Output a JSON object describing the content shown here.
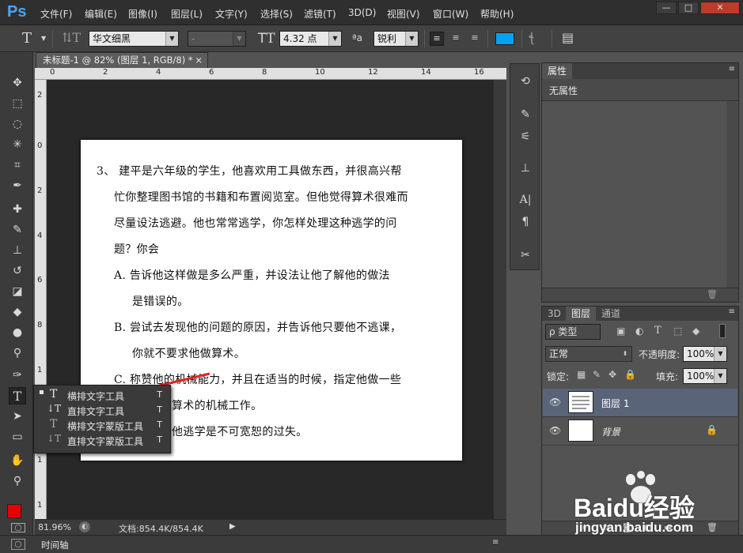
{
  "app": {
    "logo": "Ps"
  },
  "menu": [
    "文件(F)",
    "编辑(E)",
    "图像(I)",
    "图层(L)",
    "文字(Y)",
    "选择(S)",
    "滤镜(T)",
    "3D(D)",
    "视图(V)",
    "窗口(W)",
    "帮助(H)"
  ],
  "window_buttons": {
    "min": "—",
    "max": "□",
    "close": "✕"
  },
  "options": {
    "font_family": "华文细黑",
    "font_style": "-",
    "font_size": "4.32 点",
    "aa_label": "ªa",
    "antialias": "锐利",
    "color_hex": "#0aa0f0"
  },
  "document": {
    "tab_title": "未标题-1 @ 82% (图层 1, RGB/8) *",
    "close": "×",
    "ruler_h": [
      "0",
      "2",
      "4",
      "6",
      "8",
      "10",
      "12",
      "14",
      "16"
    ],
    "ruler_v": [
      "2",
      "0",
      "2",
      "4",
      "6",
      "8",
      "1",
      "1",
      "1",
      "1"
    ],
    "lines": [
      "3、  建平是六年级的学生，他喜欢用工具做东西，并很高兴帮",
      "忙你整理图书馆的书籍和布置阅览室。但他觉得算术很难而",
      "尽量设法逃避。他也常常逃学，你怎样处理这种逃学的问",
      "题？你会",
      "A.   告诉他这样做是多么严重，并设法让他了解他的做法",
      "是错误的。",
      "B.   尝试去发现他的问题的原因，并告诉他只要他不逃课，",
      "你就不要求他做算术。",
      "C.   称赞他的机械能力，并且在适当的时候，指定他做一些",
      "算术的机械工作。",
      "他逃学是不可宽恕的过失。"
    ]
  },
  "status": {
    "zoom": "81.96%",
    "doc": "文档:854.4K/854.4K"
  },
  "timeline": {
    "label": "时间轴"
  },
  "flyout": [
    {
      "label": "横排文字工具",
      "key": "T",
      "icon": "T",
      "active": true
    },
    {
      "label": "直排文字工具",
      "key": "T",
      "icon": "↓T",
      "active": false
    },
    {
      "label": "横排文字蒙版工具",
      "key": "T",
      "icon": "T",
      "active": false
    },
    {
      "label": "直排文字蒙版工具",
      "key": "T",
      "icon": "↓T",
      "active": false
    }
  ],
  "properties": {
    "tab": "属性",
    "body": "无属性"
  },
  "layers_panel": {
    "tabs": [
      "3D",
      "图层",
      "通道"
    ],
    "filter_kind": "ρ 类型",
    "blend_mode": "正常",
    "opacity_label": "不透明度:",
    "opacity": "100%",
    "lock_label": "锁定:",
    "fill_label": "填充:",
    "fill": "100%",
    "layers": [
      {
        "name": "图层 1",
        "selected": true
      },
      {
        "name": "背景",
        "selected": false
      }
    ]
  },
  "watermark": {
    "brand": "Baidu经验",
    "url": "jingyan.baidu.com"
  },
  "colors": {
    "foreground": "#e60000",
    "background": "#ffffff",
    "accent": "#4fa3f0"
  }
}
